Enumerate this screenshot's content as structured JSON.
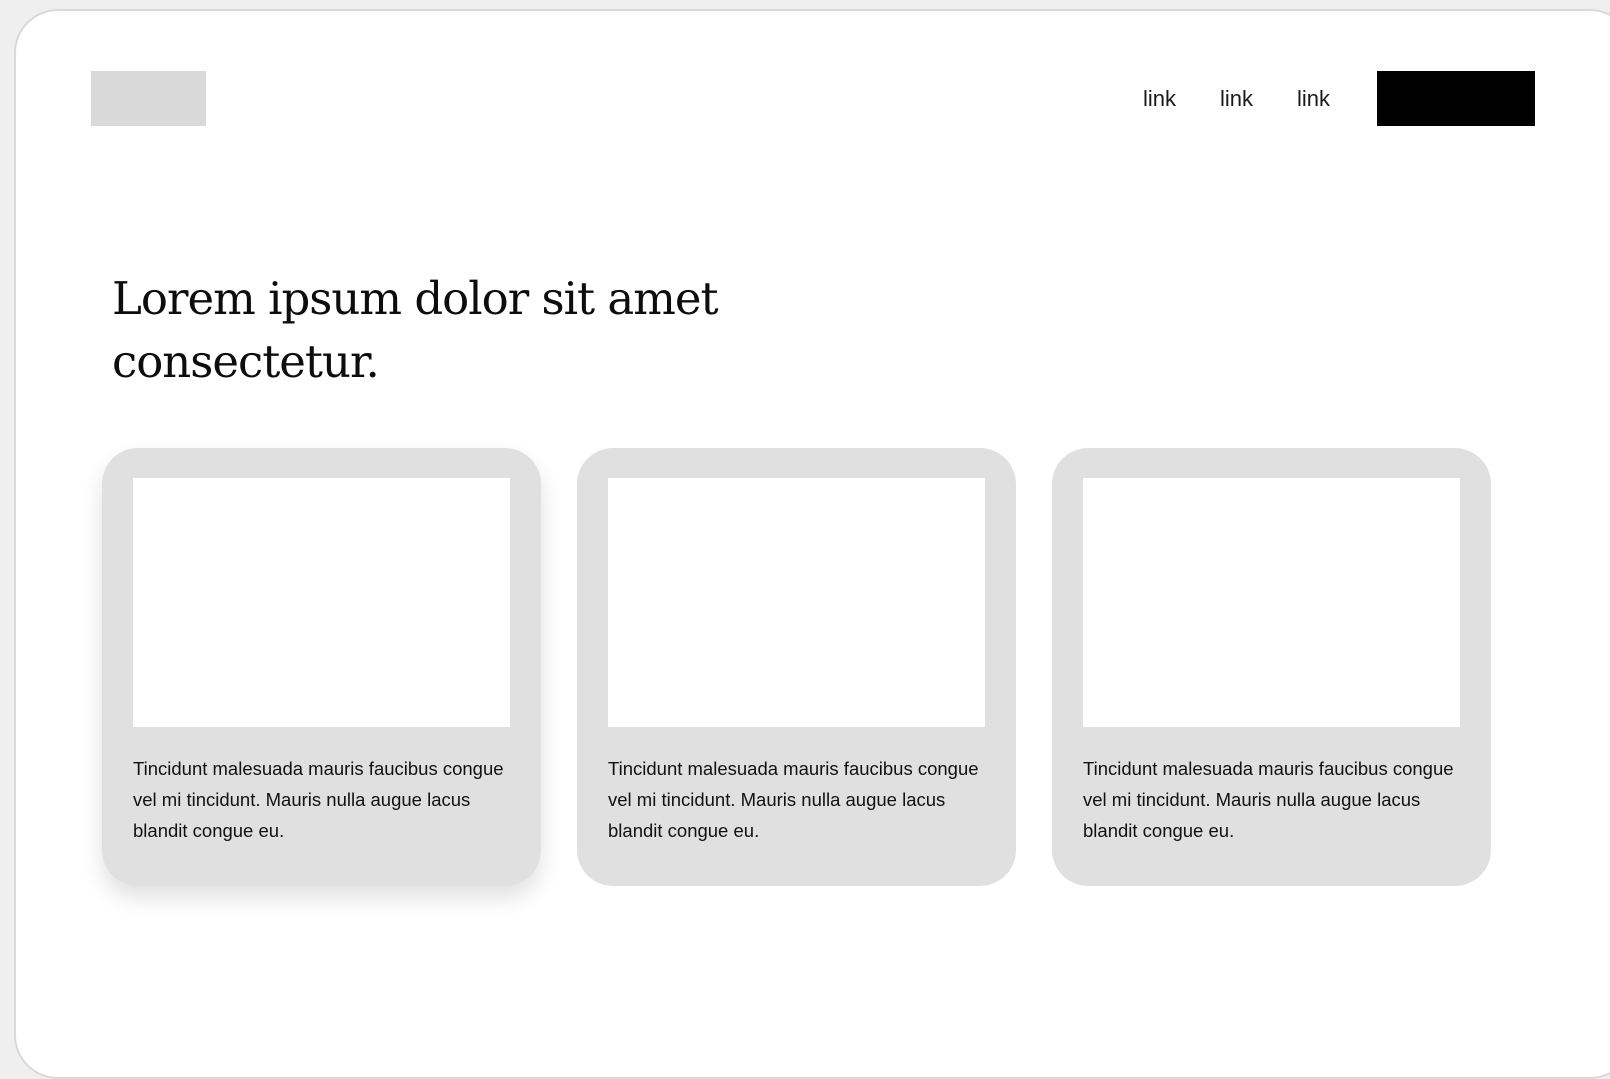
{
  "header": {
    "nav_links": [
      {
        "label": "link"
      },
      {
        "label": "link"
      },
      {
        "label": "link"
      }
    ],
    "cta_label": ""
  },
  "hero": {
    "headline": "Lorem ipsum dolor sit amet consectetur."
  },
  "cards": [
    {
      "text": "Tincidunt malesuada mauris faucibus congue vel mi tincidunt. Mauris nulla augue lacus blandit congue eu."
    },
    {
      "text": "Tincidunt malesuada mauris faucibus congue vel mi tincidunt. Mauris nulla augue lacus blandit congue eu."
    },
    {
      "text": "Tincidunt malesuada mauris faucibus congue vel mi tincidunt. Mauris nulla augue lacus blandit congue eu."
    }
  ],
  "colors": {
    "page_background": "#efefef",
    "window_background": "#ffffff",
    "logo_placeholder": "#d9d9d9",
    "cta_button": "#000000",
    "card_background": "#e0e0e0",
    "card_image": "#ffffff"
  }
}
